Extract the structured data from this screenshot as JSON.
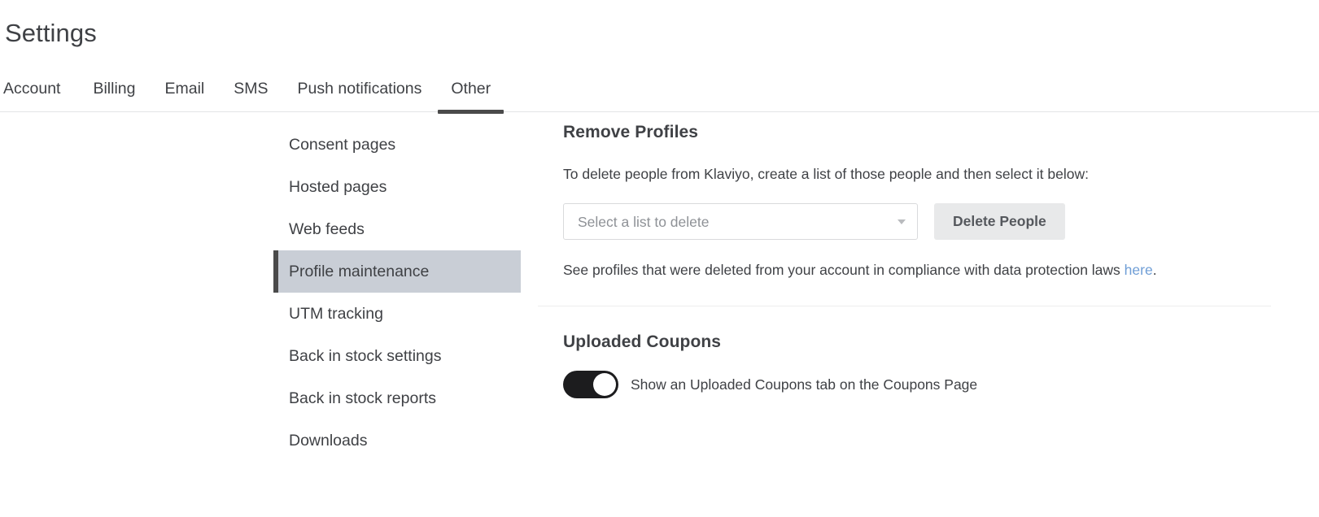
{
  "header": {
    "title": "Settings"
  },
  "tabs": [
    {
      "label": "Account",
      "active": false
    },
    {
      "label": "Billing",
      "active": false
    },
    {
      "label": "Email",
      "active": false
    },
    {
      "label": "SMS",
      "active": false
    },
    {
      "label": "Push notifications",
      "active": false
    },
    {
      "label": "Other",
      "active": true
    }
  ],
  "sidenav": {
    "items": [
      {
        "label": "Consent pages",
        "active": false
      },
      {
        "label": "Hosted pages",
        "active": false
      },
      {
        "label": "Web feeds",
        "active": false
      },
      {
        "label": "Profile maintenance",
        "active": true
      },
      {
        "label": "UTM tracking",
        "active": false
      },
      {
        "label": "Back in stock settings",
        "active": false
      },
      {
        "label": "Back in stock reports",
        "active": false
      },
      {
        "label": "Downloads",
        "active": false
      }
    ]
  },
  "remove_profiles": {
    "title": "Remove Profiles",
    "description": "To delete people from Klaviyo, create a list of those people and then select it below:",
    "select_placeholder": "Select a list to delete",
    "select_value": "",
    "delete_button": "Delete People",
    "note_prefix": "See profiles that were deleted from your account in compliance with data protection laws ",
    "note_link": "here",
    "note_suffix": "."
  },
  "uploaded_coupons": {
    "title": "Uploaded Coupons",
    "toggle_label": "Show an Uploaded Coupons tab on the Coupons Page",
    "toggle_on": true
  },
  "colors": {
    "link": "#6f9ed6",
    "active_tab_underline": "#4a4a4a",
    "active_nav_bg": "#c9ced6",
    "toggle_on_bg": "#1c1c1e",
    "button_bg": "#e8e9ea"
  }
}
